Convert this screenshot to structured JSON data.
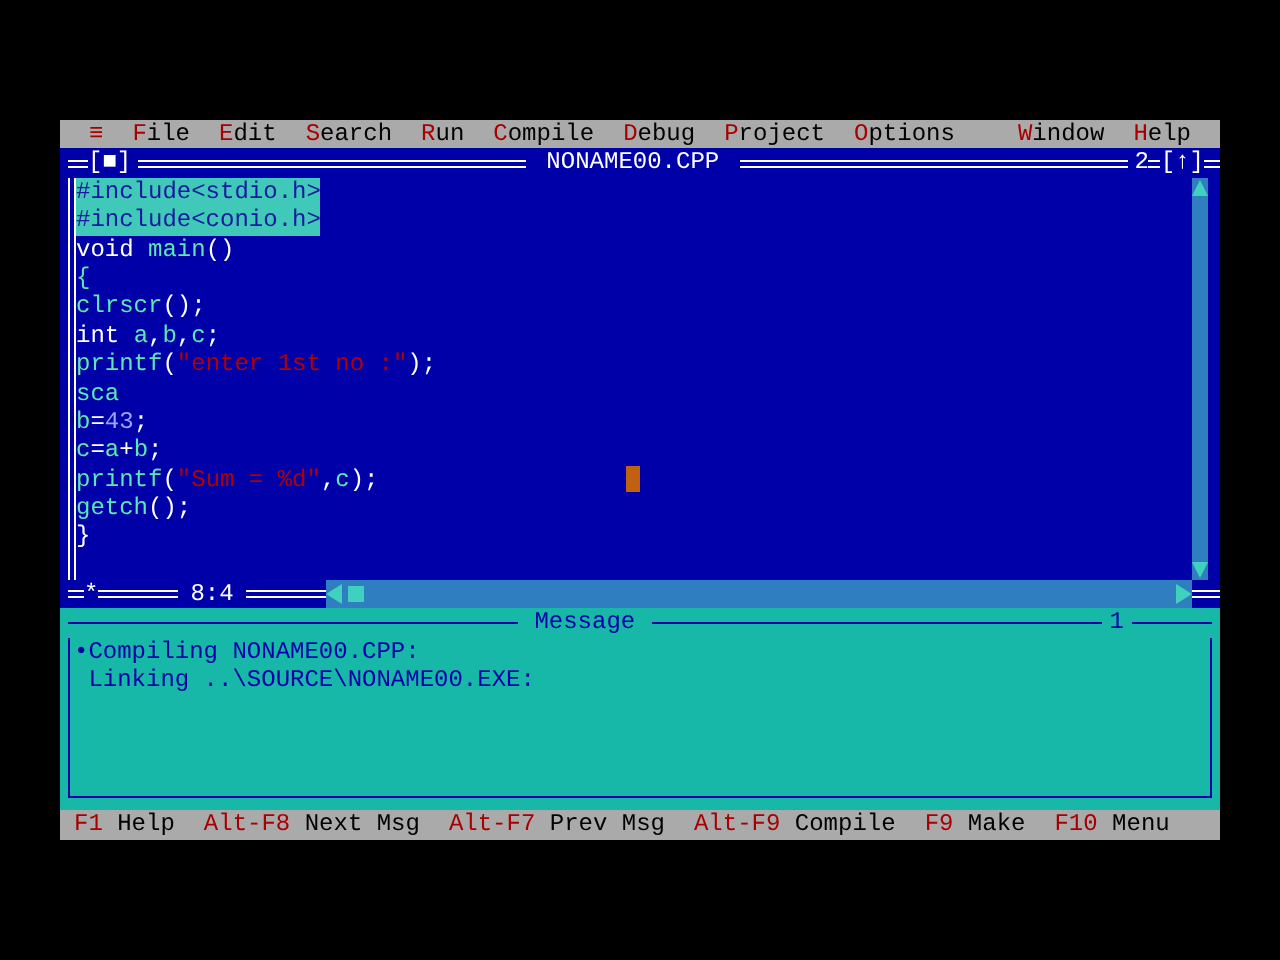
{
  "menu": [
    {
      "hot": "≡"
    },
    {
      "hot": "F",
      "rest": "ile"
    },
    {
      "hot": "E",
      "rest": "dit"
    },
    {
      "hot": "S",
      "rest": "earch"
    },
    {
      "hot": "R",
      "rest": "un"
    },
    {
      "hot": "C",
      "rest": "ompile"
    },
    {
      "hot": "D",
      "rest": "ebug"
    },
    {
      "hot": "P",
      "rest": "roject"
    },
    {
      "hot": "O",
      "rest": "ptions"
    },
    {
      "hot": "W",
      "rest": "indow"
    },
    {
      "hot": "H",
      "rest": "elp"
    }
  ],
  "editor": {
    "close": "[■]",
    "title": "NONAME00.CPP",
    "window_number": "2",
    "zoom": "[↑]",
    "modified_mark": "*",
    "position": "8:4",
    "lines": [
      {
        "selected": true,
        "segments": [
          {
            "text": "#include<stdio.h>",
            "kind": "plain"
          }
        ]
      },
      {
        "selected": true,
        "segments": [
          {
            "text": "#include<conio.h>",
            "kind": "plain"
          }
        ]
      },
      {
        "selected": false,
        "segments": [
          {
            "text": "void ",
            "kind": "keyword"
          },
          {
            "text": "main",
            "kind": "ident"
          },
          {
            "text": "()",
            "kind": "keyword"
          }
        ]
      },
      {
        "selected": false,
        "segments": [
          {
            "text": "{",
            "kind": "ident"
          }
        ]
      },
      {
        "selected": false,
        "segments": [
          {
            "text": "clrscr",
            "kind": "ident"
          },
          {
            "text": "();",
            "kind": "keyword"
          }
        ]
      },
      {
        "selected": false,
        "segments": [
          {
            "text": "int ",
            "kind": "keyword"
          },
          {
            "text": "a",
            "kind": "ident"
          },
          {
            "text": ",",
            "kind": "keyword"
          },
          {
            "text": "b",
            "kind": "ident"
          },
          {
            "text": ",",
            "kind": "keyword"
          },
          {
            "text": "c",
            "kind": "ident"
          },
          {
            "text": ";",
            "kind": "keyword"
          }
        ]
      },
      {
        "selected": false,
        "segments": [
          {
            "text": "printf",
            "kind": "ident"
          },
          {
            "text": "(",
            "kind": "keyword"
          },
          {
            "text": "\"enter 1st no :\"",
            "kind": "string"
          },
          {
            "text": ");",
            "kind": "keyword"
          }
        ]
      },
      {
        "selected": false,
        "segments": [
          {
            "text": "sca",
            "kind": "ident"
          }
        ]
      },
      {
        "selected": false,
        "segments": [
          {
            "text": "b",
            "kind": "ident"
          },
          {
            "text": "=",
            "kind": "keyword"
          },
          {
            "text": "43",
            "kind": "number"
          },
          {
            "text": ";",
            "kind": "keyword"
          }
        ]
      },
      {
        "selected": false,
        "segments": [
          {
            "text": "c",
            "kind": "ident"
          },
          {
            "text": "=",
            "kind": "keyword"
          },
          {
            "text": "a",
            "kind": "ident"
          },
          {
            "text": "+",
            "kind": "keyword"
          },
          {
            "text": "b",
            "kind": "ident"
          },
          {
            "text": ";",
            "kind": "keyword"
          }
        ]
      },
      {
        "selected": false,
        "segments": [
          {
            "text": "printf",
            "kind": "ident"
          },
          {
            "text": "(",
            "kind": "keyword"
          },
          {
            "text": "\"Sum = %d\"",
            "kind": "string"
          },
          {
            "text": ",",
            "kind": "keyword"
          },
          {
            "text": "c",
            "kind": "ident"
          },
          {
            "text": ");",
            "kind": "keyword"
          }
        ]
      },
      {
        "selected": false,
        "segments": [
          {
            "text": "getch",
            "kind": "ident"
          },
          {
            "text": "();",
            "kind": "keyword"
          }
        ]
      },
      {
        "selected": false,
        "segments": [
          {
            "text": "}",
            "kind": "keyword"
          }
        ]
      }
    ]
  },
  "message_window": {
    "title": "Message",
    "window_number": "1",
    "lines": [
      "•Compiling NONAME00.CPP:",
      " Linking ..\\SOURCE\\NONAME00.EXE:"
    ]
  },
  "status_bar": [
    {
      "key": "F1",
      "label": "Help"
    },
    {
      "key": "Alt-F8",
      "label": "Next Msg"
    },
    {
      "key": "Alt-F7",
      "label": "Prev Msg"
    },
    {
      "key": "Alt-F9",
      "label": "Compile"
    },
    {
      "key": "F9",
      "label": "Make"
    },
    {
      "key": "F10",
      "label": "Menu"
    }
  ]
}
